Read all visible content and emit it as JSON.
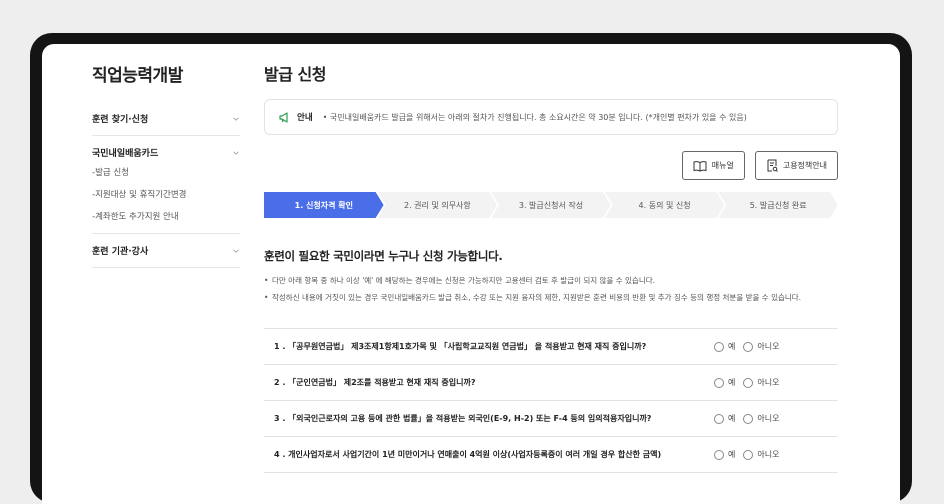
{
  "sidebar": {
    "title": "직업능력개발",
    "groups": [
      {
        "label": "훈련 찾기·신청",
        "subitems": []
      },
      {
        "label": "국민내일배움카드",
        "subitems": [
          "-발급 신청",
          "-지원대상 및 휴직기간변경",
          "-계좌한도 추가지원 안내"
        ]
      },
      {
        "label": "훈련 기관·강사",
        "subitems": []
      }
    ]
  },
  "main": {
    "title": "발급 신청",
    "notice": {
      "label": "안내",
      "text": "• 국민내일배움카드 발급을 위해서는 아래의 절차가 진행됩니다. 총 소요시간은 약 30분 입니다. (*개인별 편차가 있을 수 있음)"
    },
    "buttons": {
      "manual": "매뉴얼",
      "policy": "고용정책안내"
    },
    "steps": [
      "1. 신청자격 확인",
      "2. 권리 및 의무사항",
      "3. 발급신청서 작성",
      "4. 동의 및 신청",
      "5. 발급신청 완료"
    ],
    "section_title": "훈련이 필요한 국민이라면 누구나 신청 가능합니다.",
    "bullets": [
      "다만 아래 항목 중 하나 이상 '예' 에 해당하는 경우에는 신청은 가능하지만 고용센터 검토 후 발급이 되지 않을 수 있습니다.",
      "작성하신 내용에 거짓이 있는 경우 국민내일배움카드 발급 취소, 수강 또는 지원 융자의 제한, 지원받은 훈련 비용의 반환 및 추가 징수 등의 행정 처분을 받을 수 있습니다."
    ],
    "questions": [
      "1 . 「공무원연금법」 제3조제1항제1호가목 및 「사립학교교직원 연금법」 을 적용받고 현재 재직 중입니까?",
      "2 . 「군인연금법」 제2조를 적용받고 현재 재직 중입니까?",
      "3 . 「외국인근로자의 고용 등에 관한 법률」을 적용받는 외국인(E-9, H-2) 또는 F-4 등의 임의적용자입니까?",
      "4 . 개인사업자로서 사업기간이 1년 미만이거나 연매출이 4억원 이상(사업자등록증이 여러 개일 경우 합산한 금액)"
    ],
    "option_yes": "예",
    "option_no": "아니오"
  },
  "colors": {
    "accent": "#4a6ee8",
    "notice_icon": "#2e9e4f"
  }
}
